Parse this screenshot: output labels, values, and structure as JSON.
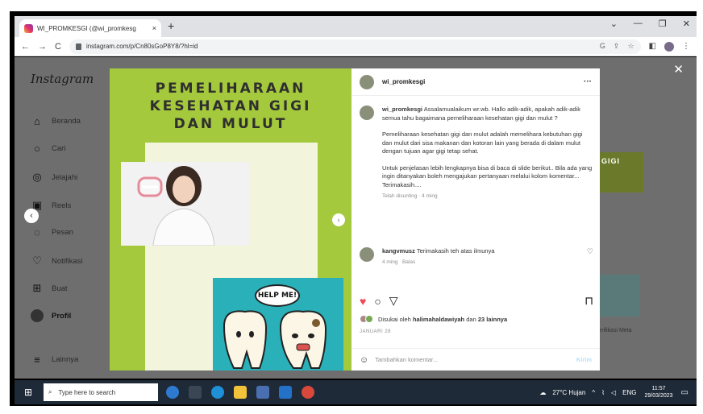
{
  "browser": {
    "tab_title": "WI_PROMKESGI (@wi_promkesg",
    "tab_close": "×",
    "new_tab": "+",
    "url": "instagram.com/p/Cn80sGoP8Y8/?hl=id",
    "window_controls": [
      "⌄",
      "—",
      "❐",
      "✕"
    ]
  },
  "sidebar": {
    "logo": "Instagram",
    "items": [
      {
        "label": "Beranda",
        "icon": "home-icon",
        "glyph": "⌂"
      },
      {
        "label": "Cari",
        "icon": "search-icon",
        "glyph": "○"
      },
      {
        "label": "Jelajahi",
        "icon": "compass-icon",
        "glyph": "◎"
      },
      {
        "label": "Reels",
        "icon": "reels-icon",
        "glyph": "▣"
      },
      {
        "label": "Pesan",
        "icon": "messenger-icon",
        "glyph": "◌"
      },
      {
        "label": "Notifikasi",
        "icon": "heart-icon",
        "glyph": "♡"
      },
      {
        "label": "Buat",
        "icon": "plus-square-icon",
        "glyph": "⊞"
      },
      {
        "label": "Profil",
        "icon": "profile-avatar",
        "glyph": ""
      },
      {
        "label": "Lainnya",
        "icon": "menu-icon",
        "glyph": "≡"
      }
    ]
  },
  "background": {
    "caption_fragment": "Verifikasi Meta",
    "fragment_text": "GIGI"
  },
  "post": {
    "image_title_lines": [
      "PEMELIHARAAN",
      "KESEHATAN GIGI",
      "DAN MULUT"
    ],
    "help_text": "HELP ME!",
    "username": "wi_promkesgi",
    "more": "···",
    "caption_user": "wi_promkesgi",
    "caption_paragraphs": [
      "Assalamualaikum wr.wb. Hallo adik-adik, apakah adik-adik semua tahu bagaimana pemeliharaan kesehatan gigi dan mulut ?",
      "Pemeliharaan kesehatan gigi dan mulut adalah memelihara kebutuhan gigi dan mulut dari sisa makanan dan kotoran lain yang berada di dalam mulut dengan tujuan agar gigi tetap sehat.",
      "Untuk penjelasan lebih lengkapnya bisa di baca di slide berikut.. Bila ada yang ingin ditanyakan boleh mengajukan pertanyaan melalui kolom komentar... Terimakasih...."
    ],
    "edited": "Telah disunting · 4 ming",
    "comment": {
      "user": "kangvmusz",
      "text": "Terimakasih teh atas ilmunya",
      "time": "4 ming",
      "reply": "Balas"
    },
    "likes_prefix": "Disukai oleh",
    "likes_user": "halimahaldawiyah",
    "likes_mid": "dan",
    "likes_count": "23 lainnya",
    "date": "JANUARI 28",
    "add_comment_placeholder": "Tambahkan komentar...",
    "send_label": "Kirim"
  },
  "taskbar": {
    "search_placeholder": "Type here to search",
    "weather": "27°C Hujan",
    "lang": "ENG",
    "time": "11:57",
    "date": "29/03/2023"
  }
}
